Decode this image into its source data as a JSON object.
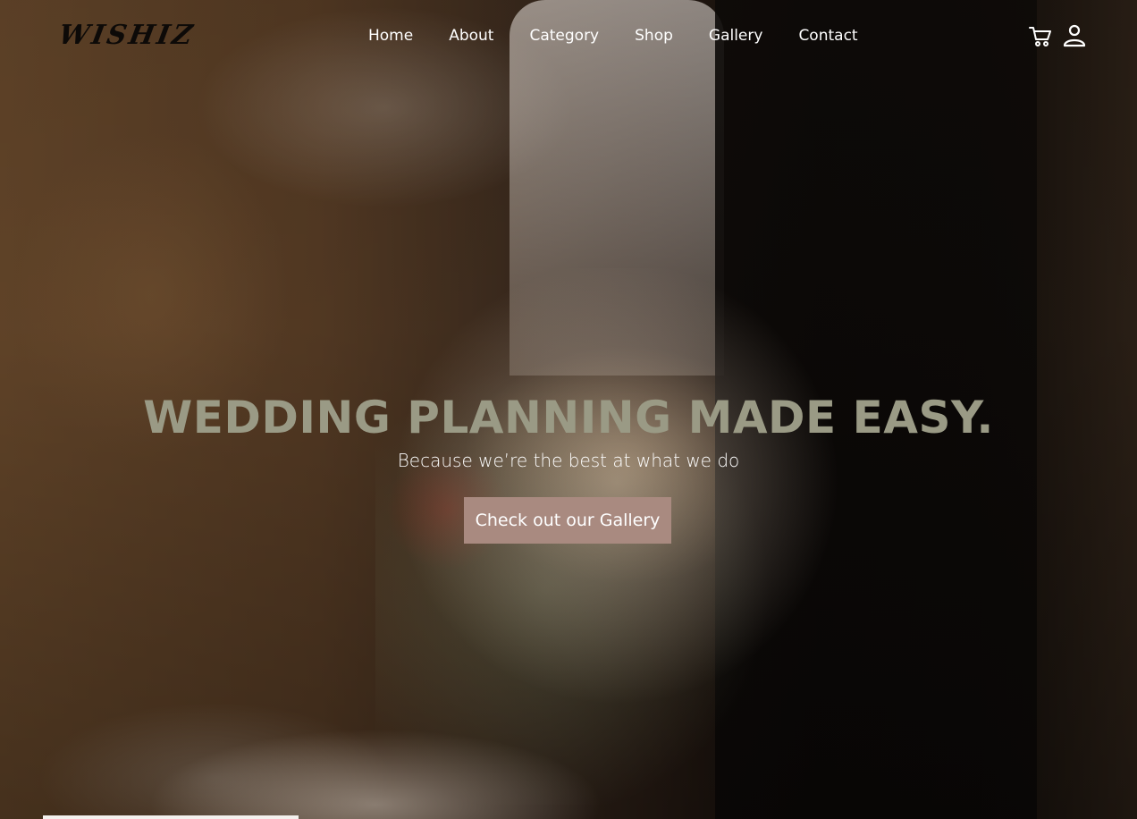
{
  "brand": {
    "logo_text": "WISHIZ"
  },
  "nav": {
    "items": [
      {
        "label": "Home"
      },
      {
        "label": "About"
      },
      {
        "label": "Category"
      },
      {
        "label": "Shop"
      },
      {
        "label": "Gallery"
      },
      {
        "label": "Contact"
      }
    ],
    "icons": [
      "cart-icon",
      "user-icon"
    ]
  },
  "hero": {
    "headline": "WEDDING PLANNING MADE EASY.",
    "subheadline": "Because we’re the best at what we do",
    "cta_label": "Check out our Gallery"
  },
  "colors": {
    "headline": "#9a9a85",
    "cta_background": "#a98a80",
    "nav_text": "#ffffff"
  }
}
